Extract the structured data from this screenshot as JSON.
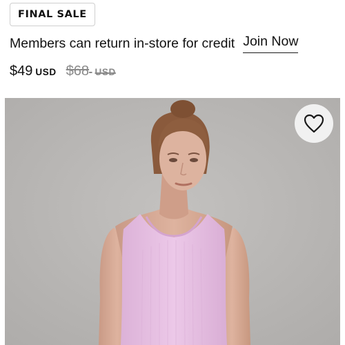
{
  "badge": {
    "label": "FINAL SALE"
  },
  "promo": {
    "message": "Members can return in-store for credit",
    "link_label": "Join Now"
  },
  "price": {
    "current": "$49",
    "current_currency": "USD",
    "original": "$68",
    "original_currency": "USD"
  },
  "product_image": {
    "wishlist_icon": "heart-outline-icon"
  },
  "colors": {
    "text": "#1a1a1a",
    "strikethrough": "#8a8a8a",
    "photo_background": "#b9b7b5",
    "tank_color": "#e8c2e3"
  }
}
